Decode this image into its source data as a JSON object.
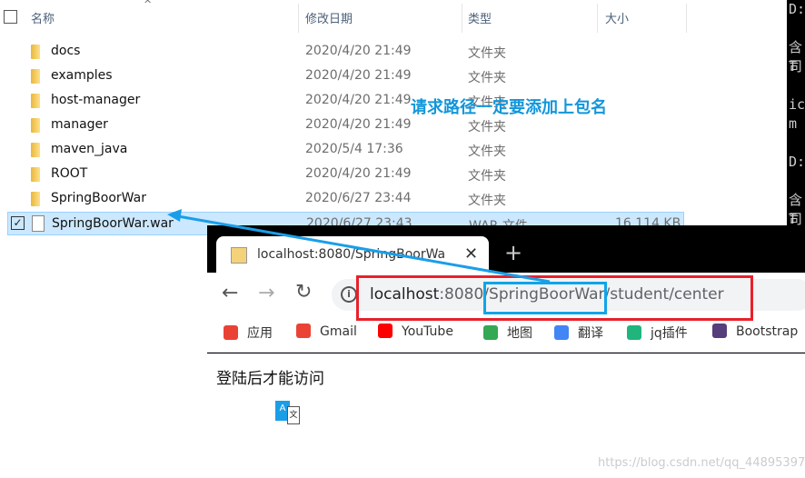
{
  "explorer": {
    "columns": {
      "name": "名称",
      "date": "修改日期",
      "type": "类型",
      "size": "大小"
    },
    "rows": [
      {
        "name": "docs",
        "date": "2020/4/20 21:49",
        "type": "文件夹",
        "size": ""
      },
      {
        "name": "examples",
        "date": "2020/4/20 21:49",
        "type": "文件夹",
        "size": ""
      },
      {
        "name": "host-manager",
        "date": "2020/4/20 21:49",
        "type": "文件夹",
        "size": ""
      },
      {
        "name": "manager",
        "date": "2020/4/20 21:49",
        "type": "文件夹",
        "size": ""
      },
      {
        "name": "maven_java",
        "date": "2020/5/4 17:36",
        "type": "文件夹",
        "size": ""
      },
      {
        "name": "ROOT",
        "date": "2020/4/20 21:49",
        "type": "文件夹",
        "size": ""
      },
      {
        "name": "SpringBoorWar",
        "date": "2020/6/27 23:44",
        "type": "文件夹",
        "size": ""
      },
      {
        "name": "SpringBoorWar.war",
        "date": "2020/6/27 23:43",
        "type": "WAR 文件",
        "size": "16,114 KB",
        "selected": true
      }
    ]
  },
  "terminal": {
    "lines": [
      "D:",
      "",
      "含T",
      "司",
      "",
      "ic",
      "m",
      "",
      "D:",
      "",
      "含T",
      "司"
    ]
  },
  "annotation": {
    "text": "请求路径一定要添加上包名",
    "color": "#1296db",
    "box_red": "#e8212b",
    "box_blue": "#0ea5e9"
  },
  "browser": {
    "tab_title": "localhost:8080/SpringBoorWa",
    "url_host": "localhost",
    "url_port": ":8080/",
    "url_path_highlight": "SpringBoorWar",
    "url_rest": "/student/center",
    "bookmarks": [
      "应用",
      "Gmail",
      "YouTube",
      "地图",
      "翻译",
      "jq插件",
      "Bootstrap"
    ],
    "page_text": "登陆后才能访问",
    "watermark": "https://blog.csdn.net/qq_44895397"
  }
}
